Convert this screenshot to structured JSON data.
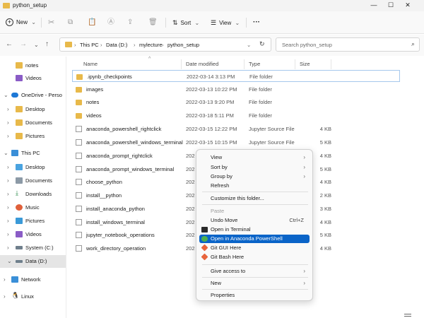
{
  "window": {
    "title": "python_setup"
  },
  "toolbar": {
    "new_label": "New",
    "sort_label": "Sort",
    "view_label": "View",
    "more_label": "···"
  },
  "address": {
    "crumbs": [
      "This PC",
      "Data (D:)",
      "mylecture",
      "python_setup"
    ],
    "search_placeholder": "Search python_setup"
  },
  "sidebar": {
    "items": [
      {
        "label": "notes",
        "icon": "folder-icon"
      },
      {
        "label": "Videos",
        "icon": "videos-icon"
      },
      {
        "label": "OneDrive - Perso",
        "icon": "onedrive-icon"
      },
      {
        "label": "Desktop",
        "icon": "folder-icon"
      },
      {
        "label": "Documents",
        "icon": "folder-icon"
      },
      {
        "label": "Pictures",
        "icon": "folder-icon"
      },
      {
        "label": "This PC",
        "icon": "pc-icon"
      },
      {
        "label": "Desktop",
        "icon": "desktop-icon"
      },
      {
        "label": "Documents",
        "icon": "documents-icon"
      },
      {
        "label": "Downloads",
        "icon": "downloads-icon"
      },
      {
        "label": "Music",
        "icon": "music-icon"
      },
      {
        "label": "Pictures",
        "icon": "pictures-icon"
      },
      {
        "label": "Videos",
        "icon": "videos-icon"
      },
      {
        "label": "System (C:)",
        "icon": "drive-icon"
      },
      {
        "label": "Data (D:)",
        "icon": "drive-icon"
      },
      {
        "label": "Network",
        "icon": "network-icon"
      },
      {
        "label": "Linux",
        "icon": "linux-icon"
      }
    ]
  },
  "columns": {
    "name": "Name",
    "date": "Date modified",
    "type": "Type",
    "size": "Size"
  },
  "files": [
    {
      "name": ".ipynb_checkpoints",
      "date": "2022-03-14 3:13 PM",
      "type": "File folder",
      "size": ""
    },
    {
      "name": "images",
      "date": "2022-03-13 10:22 PM",
      "type": "File folder",
      "size": ""
    },
    {
      "name": "notes",
      "date": "2022-03-13 9:20 PM",
      "type": "File folder",
      "size": ""
    },
    {
      "name": "videos",
      "date": "2022-03-18 5:11 PM",
      "type": "File folder",
      "size": ""
    },
    {
      "name": "anaconda_powershell_rightclick",
      "date": "2022-03-15 12:22 PM",
      "type": "Jupyter Source File",
      "size": "4 KB"
    },
    {
      "name": "anaconda_powershell_windows_terminal",
      "date": "2022-03-15 10:15 PM",
      "type": "Jupyter Source File",
      "size": "5 KB"
    },
    {
      "name": "anaconda_prompt_rightclick",
      "date": "202",
      "type": "",
      "size": "4 KB"
    },
    {
      "name": "anaconda_prompt_windows_terminal",
      "date": "202",
      "type": "",
      "size": "5 KB"
    },
    {
      "name": "choose_python",
      "date": "202",
      "type": "",
      "size": "4 KB"
    },
    {
      "name": "install__python",
      "date": "202",
      "type": "",
      "size": "2 KB"
    },
    {
      "name": "install_anaconda_python",
      "date": "202",
      "type": "",
      "size": "3 KB"
    },
    {
      "name": "install_windows_terminal",
      "date": "202",
      "type": "",
      "size": "4 KB"
    },
    {
      "name": "jupyter_notebook_operations",
      "date": "202",
      "type": "",
      "size": "5 KB"
    },
    {
      "name": "work_directory_operation",
      "date": "202",
      "type": "",
      "size": "4 KB"
    }
  ],
  "context_menu": {
    "view": "View",
    "sort_by": "Sort by",
    "group_by": "Group by",
    "refresh": "Refresh",
    "customize": "Customize this folder...",
    "paste": "Paste",
    "undo_move": "Undo Move",
    "undo_shortcut": "Ctrl+Z",
    "open_terminal": "Open in Terminal",
    "open_anaconda_ps": "Open in Anaconda PowerShell",
    "git_gui": "Git GUI Here",
    "git_bash": "Git Bash Here",
    "give_access": "Give access to",
    "new": "New",
    "properties": "Properties"
  },
  "colors": {
    "accent": "#0a64c8",
    "folder": "#e8b94a",
    "selection": "#e5e5e5"
  }
}
